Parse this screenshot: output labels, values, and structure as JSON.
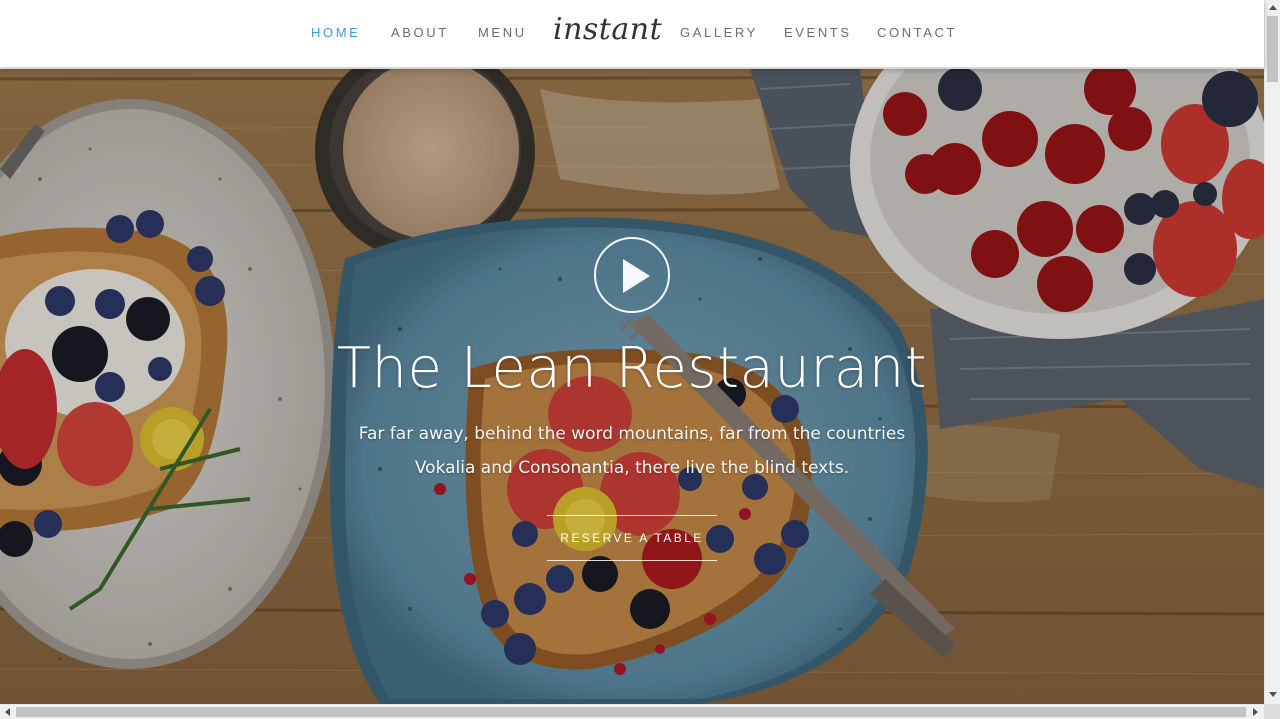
{
  "nav": {
    "items": [
      {
        "label": "HOME",
        "active": true
      },
      {
        "label": "ABOUT",
        "active": false
      },
      {
        "label": "MENU",
        "active": false
      },
      {
        "label": "GALLERY",
        "active": false
      },
      {
        "label": "EVENTS",
        "active": false
      },
      {
        "label": "CONTACT",
        "active": false
      }
    ],
    "logo_text": "instant",
    "active_color": "#3d9be0",
    "link_color": "#6c6c6c"
  },
  "hero": {
    "title": "The Lean Restaurant",
    "text": "Far far away, behind the word mountains, far from the countries Vokalia and Consonantia, there live the blind texts.",
    "button_label": "RESERVE A TABLE",
    "play_icon": "play-icon",
    "background_image": "overhead photo of breakfast toast with berries on blue and white plates, coffee cup, bowl of cherries on wooden table"
  }
}
